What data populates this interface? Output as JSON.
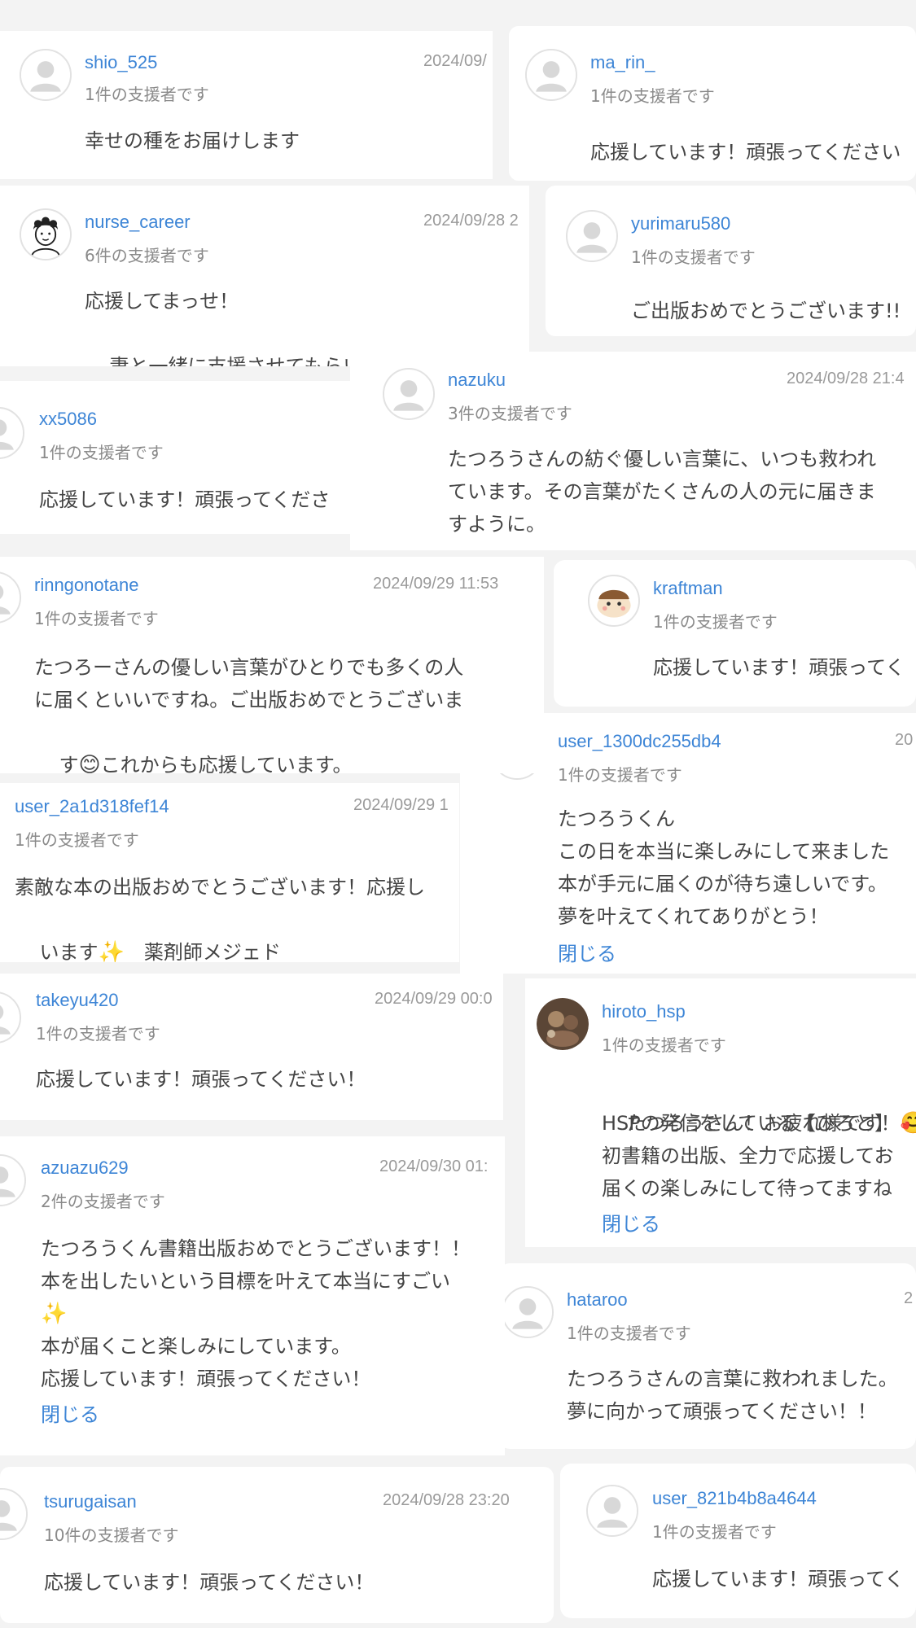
{
  "comments": {
    "shio": {
      "username": "shio_525",
      "date": "2024/09/",
      "supporters": "1件の支援者です",
      "message": "幸せの種をお届けします"
    },
    "marin": {
      "username": "ma_rin_",
      "supporters": "1件の支援者です",
      "message": "応援しています！頑張ってください"
    },
    "nurse": {
      "username": "nurse_career",
      "date": "2024/09/28 2",
      "supporters": "6件の支援者です",
      "line1": "応援してまっせ！",
      "line2": "妻と一緒に支援させてもらいました",
      "emoji": "👍"
    },
    "yurimaru": {
      "username": "yurimaru580",
      "supporters": "1件の支援者です",
      "message": "ご出版おめでとうございます!!"
    },
    "xx5086": {
      "username": "xx5086",
      "supporters": "1件の支援者です",
      "message": "応援しています！頑張ってくださ"
    },
    "nazuku": {
      "username": "nazuku",
      "date": "2024/09/28 21:4",
      "supporters": "3件の支援者です",
      "message": "たつろうさんの紡ぐ優しい言葉に、いつも救われ\nています。その言葉がたくさんの人の元に届きま\nすように。"
    },
    "rinngo": {
      "username": "rinngonotane",
      "date": "2024/09/29 11:53",
      "supporters": "1件の支援者です",
      "line1": "たつろーさんの優しい言葉がひとりでも多くの人",
      "line2": "に届くといいですね。ご出版おめでとうございま",
      "line3a": "す",
      "emoji": "😊",
      "line3b": "これからも応援しています。"
    },
    "kraftman": {
      "username": "kraftman",
      "supporters": "1件の支援者です",
      "message": "応援しています！頑張ってく"
    },
    "user1300": {
      "username": "user_1300dc255db4",
      "date": "20",
      "supporters": "1件の支援者です",
      "message": "たつろうくん\nこの日を本当に楽しみにして来ました\n本が手元に届くのが待ち遠しいです。\n夢を叶えてくれてありがとう！",
      "close": "閉じる"
    },
    "user2a1d": {
      "username": "user_2a1d318fef14",
      "date": "2024/09/29 1",
      "supporters": "1件の支援者です",
      "line1": "素敵な本の出版おめでとうございます！応援し",
      "line2a": "います",
      "emoji": "✨",
      "line2b": "　薬剤師メジェド"
    },
    "takeyu": {
      "username": "takeyu420",
      "date": "2024/09/29 00:0",
      "supporters": "1件の支援者です",
      "message": "応援しています！頑張ってください！"
    },
    "hiroto": {
      "username": "hiroto_hsp",
      "supporters": "1件の支援者です",
      "line1": "たつろうさん！お疲れ様です！",
      "emoji": "🥰",
      "rest": "HSPの発信をしている【ひろと】\n初書籍の出版、全力で応援してお\n届くの楽しみにして待ってますね",
      "close": "閉じる"
    },
    "azuazu": {
      "username": "azuazu629",
      "date": "2024/09/30 01:",
      "supporters": "2件の支援者です",
      "line1": "たつろうくん書籍出版おめでとうございます！！",
      "line2": "本を出したいという目標を叶えて本当にすごい",
      "sparkle": "✨",
      "rest": "本が届くこと楽しみにしています。\n応援しています！頑張ってください！",
      "close": "閉じる"
    },
    "hataroo": {
      "username": "hataroo",
      "date": "2",
      "supporters": "1件の支援者です",
      "message": "たつろうさんの言葉に救われました。\n夢に向かって頑張ってください！！"
    },
    "tsuru": {
      "username": "tsurugaisan",
      "date": "2024/09/28 23:20",
      "supporters": "10件の支援者です",
      "message": "応援しています！頑張ってください！"
    },
    "user821": {
      "username": "user_821b4b8a4644",
      "supporters": "1件の支援者です",
      "message": "応援しています！頑張ってく"
    }
  },
  "colors": {
    "link": "#3d85d6",
    "text": "#444444",
    "muted": "#8a8a8a",
    "background": "#f3f3f3"
  }
}
